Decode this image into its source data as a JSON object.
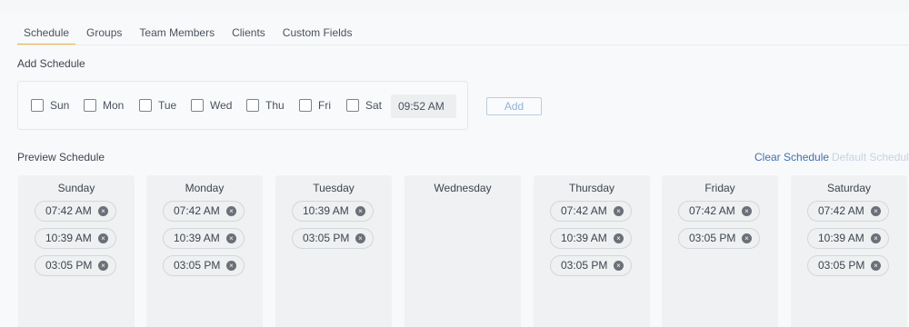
{
  "tabs": [
    "Schedule",
    "Groups",
    "Team Members",
    "Clients",
    "Custom Fields"
  ],
  "add_schedule": {
    "title": "Add Schedule",
    "days": [
      "Sun",
      "Mon",
      "Tue",
      "Wed",
      "Thu",
      "Fri",
      "Sat"
    ],
    "time_value": "09:52 AM",
    "add_label": "Add"
  },
  "preview": {
    "title": "Preview Schedule",
    "clear_label": "Clear Schedule",
    "default_label": "Default Schedule",
    "remove_icon": "×",
    "columns": [
      {
        "day": "Sunday",
        "times": [
          "07:42 AM",
          "10:39 AM",
          "03:05 PM"
        ]
      },
      {
        "day": "Monday",
        "times": [
          "07:42 AM",
          "10:39 AM",
          "03:05 PM"
        ]
      },
      {
        "day": "Tuesday",
        "times": [
          "10:39 AM",
          "03:05 PM"
        ]
      },
      {
        "day": "Wednesday",
        "times": []
      },
      {
        "day": "Thursday",
        "times": [
          "07:42 AM",
          "10:39 AM",
          "03:05 PM"
        ]
      },
      {
        "day": "Friday",
        "times": [
          "07:42 AM",
          "03:05 PM"
        ]
      },
      {
        "day": "Saturday",
        "times": [
          "07:42 AM",
          "10:39 AM",
          "03:05 PM"
        ]
      }
    ]
  }
}
